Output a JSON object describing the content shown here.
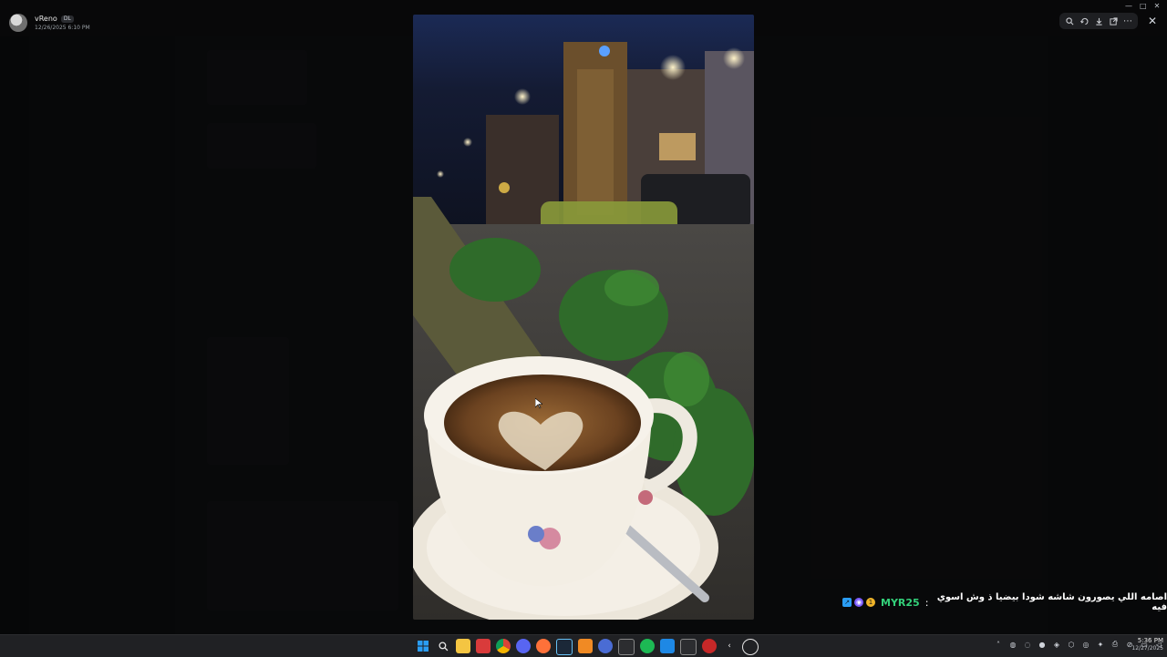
{
  "viewer": {
    "username": "vReno",
    "user_badge": "DL",
    "timestamp": "12/26/2025 6:10 PM"
  },
  "toolbar": {
    "icons": [
      "zoom-icon",
      "rotate-icon",
      "download-icon",
      "open-external-icon",
      "more-icon"
    ],
    "close_icon": "close-icon"
  },
  "image": {
    "description_icon": "coffee-cup-photo"
  },
  "overlay_message": {
    "username": "MYR25",
    "separator": ":",
    "text": "اصامه اللي يصورون شاشه شودا بيضيا ذ وش اسوي فيه"
  },
  "taskbar": {
    "apps": [
      "windows-icon",
      "search-icon",
      "file-explorer-icon",
      "app-red-icon",
      "chrome-icon",
      "discord-icon",
      "firefox-icon",
      "steam-icon",
      "app-orange-icon",
      "app-blue-icon",
      "app-grid-icon",
      "spotify-icon",
      "app-blue2-icon",
      "app-terminal-icon",
      "app-red2-icon",
      "app-back-icon",
      "app-circle-icon"
    ],
    "time": "5:36 PM",
    "date": "12/27/2025"
  },
  "colors": {
    "overlay_username": "#33d17a",
    "taskbar_bg": "#202124",
    "windows_blue": "#2a9df4"
  }
}
